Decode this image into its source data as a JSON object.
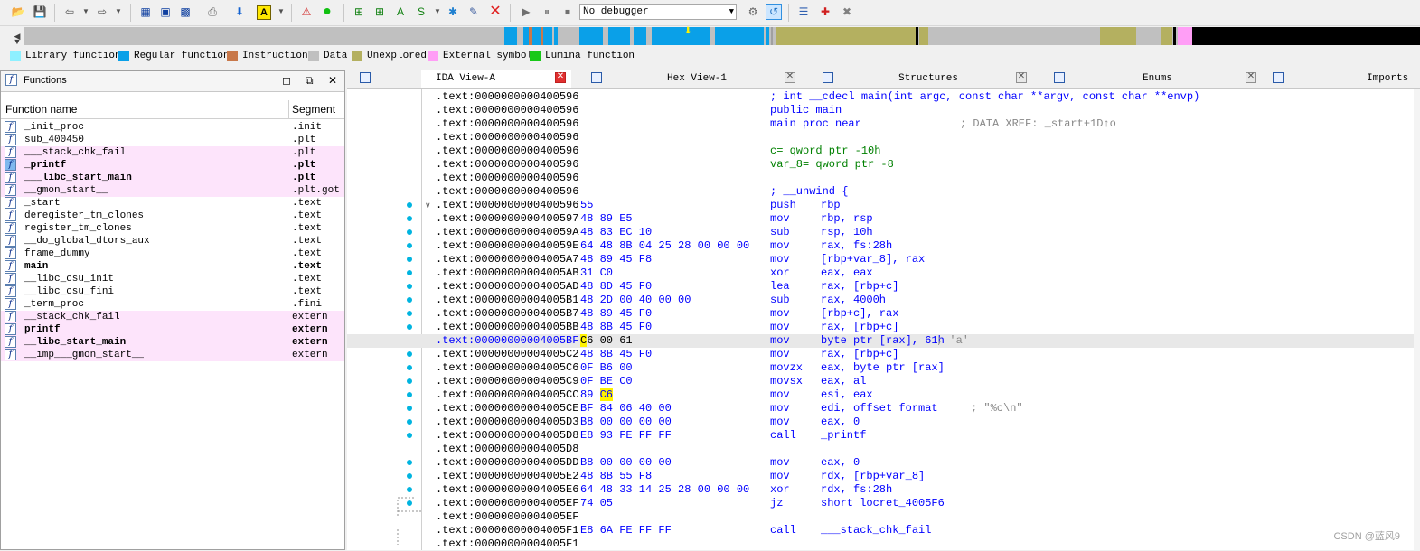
{
  "toolbar": {
    "debugger_select": "No debugger"
  },
  "legend": [
    {
      "label": "Library function",
      "color": "#8ef0ff"
    },
    {
      "label": "Regular function",
      "color": "#0aa0e8"
    },
    {
      "label": "Instruction",
      "color": "#c8784a"
    },
    {
      "label": "Data",
      "color": "#c0c0c0"
    },
    {
      "label": "Unexplored",
      "color": "#b4b060"
    },
    {
      "label": "External symbol",
      "color": "#ff9ef6"
    },
    {
      "label": "Lumina function",
      "color": "#18c818"
    }
  ],
  "functions_panel": {
    "title": "Functions",
    "col_name": "Function name",
    "col_segment": "Segment",
    "rows": [
      {
        "name": "_init_proc",
        "segment": ".init"
      },
      {
        "name": "sub_400450",
        "segment": ".plt"
      },
      {
        "name": "___stack_chk_fail",
        "segment": ".plt"
      },
      {
        "name": "_printf",
        "segment": ".plt"
      },
      {
        "name": "___libc_start_main",
        "segment": ".plt"
      },
      {
        "name": "__gmon_start__",
        "segment": ".plt.got"
      },
      {
        "name": "_start",
        "segment": ".text"
      },
      {
        "name": "deregister_tm_clones",
        "segment": ".text"
      },
      {
        "name": "register_tm_clones",
        "segment": ".text"
      },
      {
        "name": "__do_global_dtors_aux",
        "segment": ".text"
      },
      {
        "name": "frame_dummy",
        "segment": ".text"
      },
      {
        "name": "main",
        "segment": ".text"
      },
      {
        "name": "__libc_csu_init",
        "segment": ".text"
      },
      {
        "name": "__libc_csu_fini",
        "segment": ".text"
      },
      {
        "name": "_term_proc",
        "segment": ".fini"
      },
      {
        "name": "__stack_chk_fail",
        "segment": "extern"
      },
      {
        "name": "printf",
        "segment": "extern"
      },
      {
        "name": "__libc_start_main",
        "segment": "extern"
      },
      {
        "name": "__imp___gmon_start__",
        "segment": "extern"
      }
    ]
  },
  "tabs": [
    {
      "label": "IDA View-A"
    },
    {
      "label": "Hex View-1"
    },
    {
      "label": "Structures"
    },
    {
      "label": "Enums"
    },
    {
      "label": "Imports"
    }
  ],
  "disasm": {
    "decl_lines": [
      {
        "addr": ".text:0000000000400596",
        "text": "; int __cdecl main(int argc, const char **argv, const char **envp)"
      },
      {
        "addr": ".text:0000000000400596",
        "text": "public main"
      },
      {
        "addr": ".text:0000000000400596",
        "text": "main proc near",
        "comment": "; DATA XREF: _start+1D↑o"
      },
      {
        "addr": ".text:0000000000400596",
        "text": ""
      },
      {
        "addr": ".text:0000000000400596",
        "text": "c= qword ptr -10h"
      },
      {
        "addr": ".text:0000000000400596",
        "text": "var_8= qword ptr -8"
      },
      {
        "addr": ".text:0000000000400596",
        "text": ""
      },
      {
        "addr": ".text:0000000000400596",
        "text": "; __unwind {"
      }
    ],
    "lines": [
      {
        "addr": ".text:0000000000400596",
        "bytes": "55",
        "mn": "push",
        "ops": "rbp"
      },
      {
        "addr": ".text:0000000000400597",
        "bytes": "48 89 E5",
        "mn": "mov",
        "ops": "rbp, rsp"
      },
      {
        "addr": ".text:000000000040059A",
        "bytes": "48 83 EC 10",
        "mn": "sub",
        "ops": "rsp, 10h"
      },
      {
        "addr": ".text:000000000040059E",
        "bytes": "64 48 8B 04 25 28 00 00 00",
        "mn": "mov",
        "ops": "rax, fs:28h"
      },
      {
        "addr": ".text:00000000004005A7",
        "bytes": "48 89 45 F8",
        "mn": "mov",
        "ops": "[rbp+var_8], rax"
      },
      {
        "addr": ".text:00000000004005AB",
        "bytes": "31 C0",
        "mn": "xor",
        "ops": "eax, eax"
      },
      {
        "addr": ".text:00000000004005AD",
        "bytes": "48 8D 45 F0",
        "mn": "lea",
        "ops": "rax, [rbp+c]"
      },
      {
        "addr": ".text:00000000004005B1",
        "bytes": "48 2D 00 40 00 00",
        "mn": "sub",
        "ops": "rax, 4000h"
      },
      {
        "addr": ".text:00000000004005B7",
        "bytes": "48 89 45 F0",
        "mn": "mov",
        "ops": "[rbp+c], rax"
      },
      {
        "addr": ".text:00000000004005BB",
        "bytes": "48 8B 45 F0",
        "mn": "mov",
        "ops": "rax, [rbp+c]"
      },
      {
        "addr": ".text:00000000004005BF",
        "bytes": "C6 00 61",
        "mn": "mov",
        "ops": "byte ptr [rax], 61h",
        "comment": "; 'a'"
      },
      {
        "addr": ".text:00000000004005C2",
        "bytes": "48 8B 45 F0",
        "mn": "mov",
        "ops": "rax, [rbp+c]"
      },
      {
        "addr": ".text:00000000004005C6",
        "bytes": "0F B6 00",
        "mn": "movzx",
        "ops": "eax, byte ptr [rax]"
      },
      {
        "addr": ".text:00000000004005C9",
        "bytes": "0F BE C0",
        "mn": "movsx",
        "ops": "eax, al"
      },
      {
        "addr": ".text:00000000004005CC",
        "bytes": "89 C6",
        "mn": "mov",
        "ops": "esi, eax"
      },
      {
        "addr": ".text:00000000004005CE",
        "bytes": "BF 84 06 40 00",
        "mn": "mov",
        "ops": "edi, offset format",
        "comment": "; \"%c\\n\""
      },
      {
        "addr": ".text:00000000004005D3",
        "bytes": "B8 00 00 00 00",
        "mn": "mov",
        "ops": "eax, 0"
      },
      {
        "addr": ".text:00000000004005D8",
        "bytes": "E8 93 FE FF FF",
        "mn": "call",
        "ops": "_printf"
      },
      {
        "addr": ".text:00000000004005D8",
        "bytes": "",
        "mn": "",
        "ops": ""
      },
      {
        "addr": ".text:00000000004005DD",
        "bytes": "B8 00 00 00 00",
        "mn": "mov",
        "ops": "eax, 0"
      },
      {
        "addr": ".text:00000000004005E2",
        "bytes": "48 8B 55 F8",
        "mn": "mov",
        "ops": "rdx, [rbp+var_8]"
      },
      {
        "addr": ".text:00000000004005E6",
        "bytes": "64 48 33 14 25 28 00 00 00",
        "mn": "xor",
        "ops": "rdx, fs:28h"
      },
      {
        "addr": ".text:00000000004005EF",
        "bytes": "74 05",
        "mn": "jz",
        "ops": "short locret_4005F6"
      },
      {
        "addr": ".text:00000000004005EF",
        "bytes": "",
        "mn": "",
        "ops": ""
      },
      {
        "addr": ".text:00000000004005F1",
        "bytes": "E8 6A FE FF FF",
        "mn": "call",
        "ops": "___stack_chk_fail"
      },
      {
        "addr": ".text:00000000004005F1",
        "bytes": "",
        "mn": "",
        "ops": ""
      }
    ]
  },
  "watermark": "CSDN @蓝风9"
}
